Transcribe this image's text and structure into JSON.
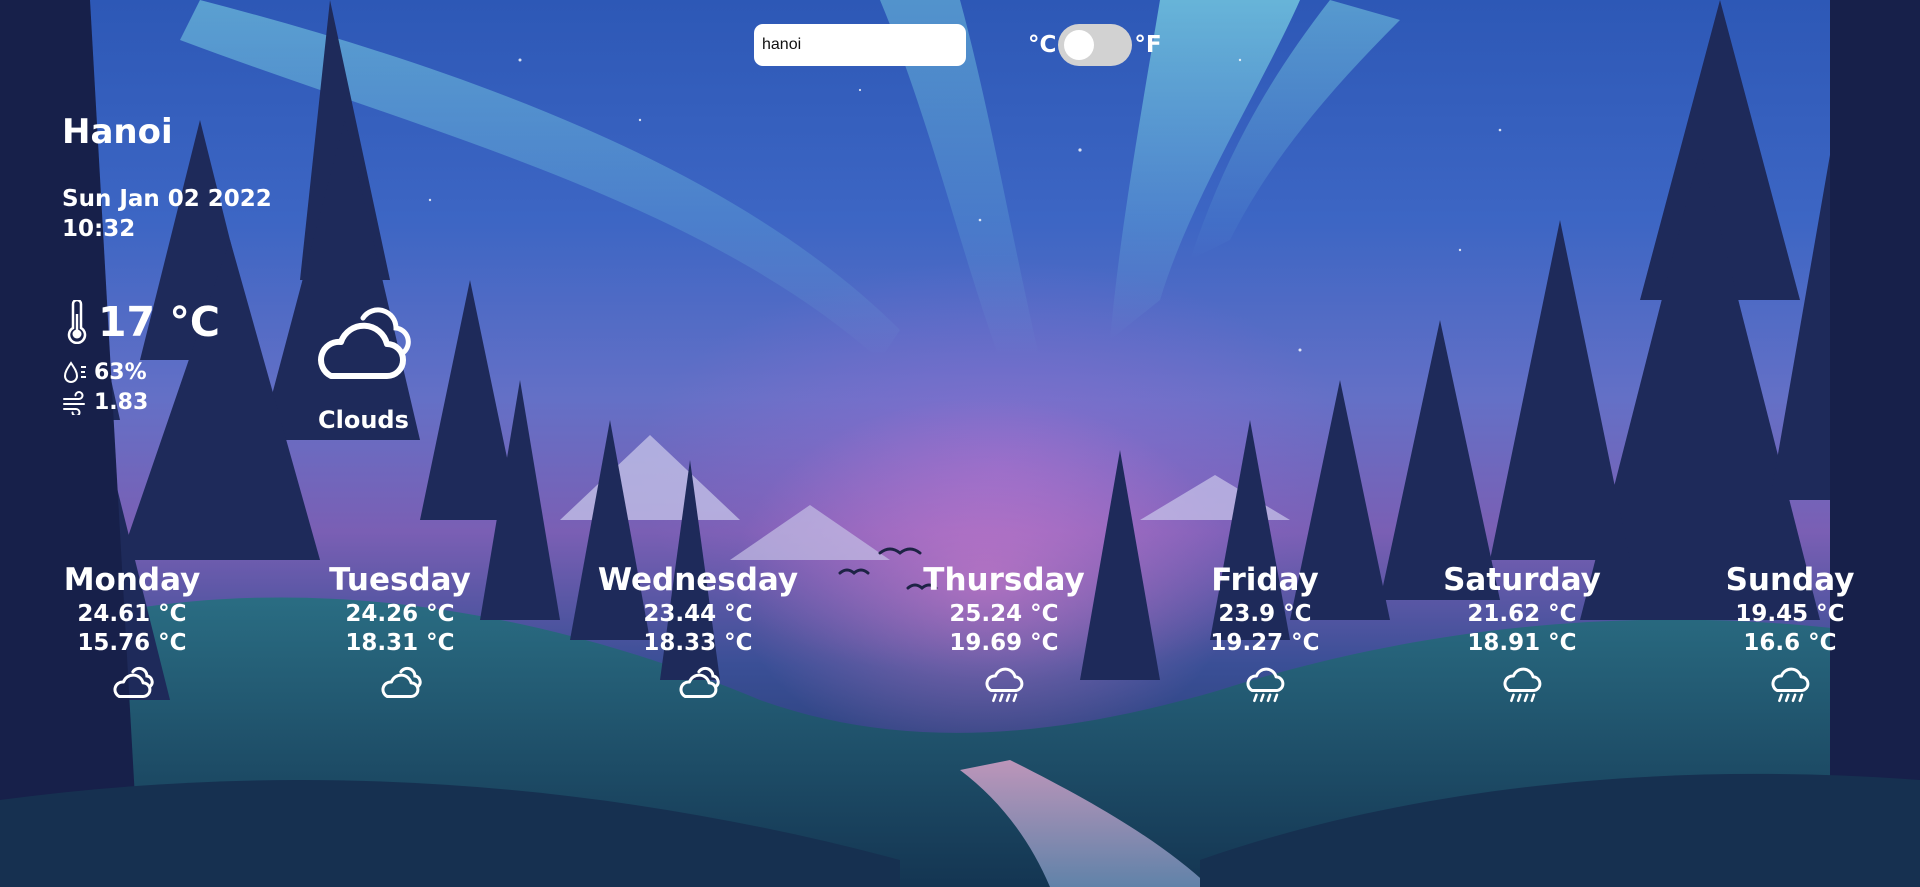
{
  "search": {
    "value": "hanoi"
  },
  "unit_toggle": {
    "celsius_label": "°C",
    "fahrenheit_label": "°F",
    "selected": "°C"
  },
  "current": {
    "city": "Hanoi",
    "date": "Sun Jan 02 2022",
    "time": "10:32",
    "temperature": "17 °C",
    "humidity": "63%",
    "wind": "1.83",
    "condition": "Clouds",
    "icon": "cloud-icon"
  },
  "forecast": [
    {
      "day": "Monday",
      "high": "24.61 °C",
      "low": "15.76 °C",
      "icon": "cloud-icon"
    },
    {
      "day": "Tuesday",
      "high": "24.26 °C",
      "low": "18.31 °C",
      "icon": "cloud-icon"
    },
    {
      "day": "Wednesday",
      "high": "23.44 °C",
      "low": "18.33 °C",
      "icon": "cloud-icon"
    },
    {
      "day": "Thursday",
      "high": "25.24 °C",
      "low": "19.69 °C",
      "icon": "rain-icon"
    },
    {
      "day": "Friday",
      "high": "23.9 °C",
      "low": "19.27 °C",
      "icon": "rain-icon"
    },
    {
      "day": "Saturday",
      "high": "21.62 °C",
      "low": "18.91 °C",
      "icon": "rain-icon"
    },
    {
      "day": "Sunday",
      "high": "19.45 °C",
      "low": "16.6 °C",
      "icon": "rain-icon"
    }
  ]
}
